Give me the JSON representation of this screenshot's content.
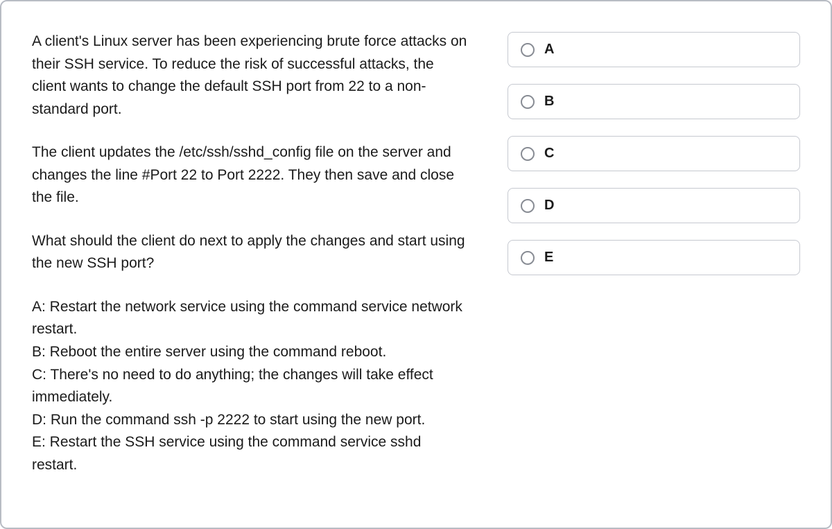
{
  "question": {
    "paragraphs": [
      "A client's Linux server has been experiencing brute force attacks on their SSH service. To reduce the risk of successful attacks, the client wants to change the default SSH port from 22 to a non-standard port.",
      "The client updates the /etc/ssh/sshd_config file on the server and changes the line #Port 22 to Port 2222. They then save and close the file.",
      "What should the client do next to apply the changes and start using the new SSH port?"
    ],
    "answers": [
      "A: Restart the network service using the command service network restart.",
      "B: Reboot the entire server using the command reboot.",
      "C: There's no need to do anything; the changes will take effect immediately.",
      "D: Run the command ssh -p 2222 to start using the new port.",
      "E: Restart the SSH service using the command service sshd restart."
    ]
  },
  "options": [
    {
      "label": "A"
    },
    {
      "label": "B"
    },
    {
      "label": "C"
    },
    {
      "label": "D"
    },
    {
      "label": "E"
    }
  ]
}
